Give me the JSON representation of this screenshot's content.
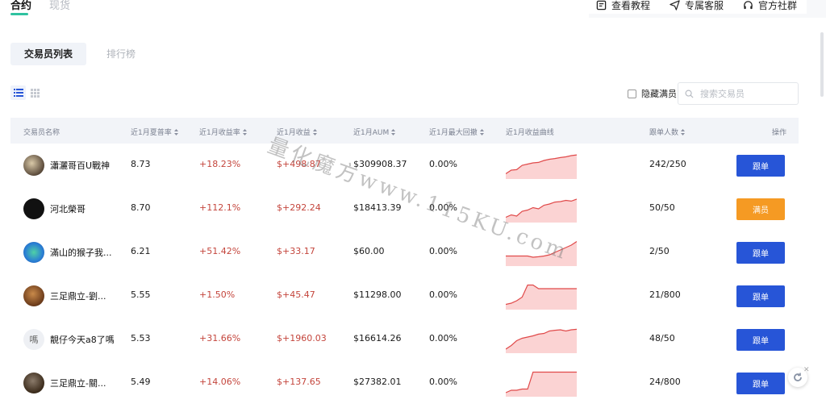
{
  "tabs": [
    {
      "label": "合约",
      "active": true
    },
    {
      "label": "现货",
      "active": false
    }
  ],
  "top_actions": [
    {
      "label": "查看教程",
      "icon": "document-icon"
    },
    {
      "label": "专属客服",
      "icon": "send-icon"
    },
    {
      "label": "官方社群",
      "icon": "headset-icon"
    }
  ],
  "subtabs": [
    {
      "label": "交易员列表",
      "active": true
    },
    {
      "label": "排行榜",
      "active": false
    }
  ],
  "view_toggle": {
    "list_icon": "list-view-icon",
    "grid_icon": "grid-view-icon",
    "active": "list"
  },
  "filters": {
    "hide_full_label": "隐藏满员",
    "hide_full_checked": false
  },
  "search": {
    "placeholder": "搜索交易员",
    "value": ""
  },
  "table": {
    "headers": {
      "name": "交易员名称",
      "sharpe": "近1月夏普率",
      "return_rate": "近1月收益率",
      "profit": "近1月收益",
      "aum": "近1月AUM",
      "max_drawdown": "近1月最大回撤",
      "curve": "近1月收益曲线",
      "followers": "跟单人数",
      "action": "操作"
    },
    "rows": [
      {
        "name": "瀟灑哥百U戰神",
        "sharpe": "8.73",
        "return_rate": "+18.23%",
        "profit": "$+498.87",
        "aum": "$309908.37",
        "drawdown": "0.00%",
        "followers": "242/250",
        "button": "跟单",
        "status": "follow",
        "curve": [
          0.15,
          0.3,
          0.32,
          0.5,
          0.55,
          0.6,
          0.62,
          0.7,
          0.75,
          0.78,
          0.82,
          0.85,
          0.9,
          0.93
        ]
      },
      {
        "name": "河北榮哥",
        "sharpe": "8.70",
        "return_rate": "+112.1%",
        "profit": "$+292.24",
        "aum": "$18413.39",
        "drawdown": "0.00%",
        "followers": "50/50",
        "button": "满员",
        "status": "full",
        "curve": [
          0.15,
          0.25,
          0.2,
          0.4,
          0.45,
          0.55,
          0.5,
          0.65,
          0.7,
          0.78,
          0.8,
          0.85,
          0.82,
          0.9
        ]
      },
      {
        "name": "滿山的猴子我...",
        "sharpe": "6.21",
        "return_rate": "+51.42%",
        "profit": "$+33.17",
        "aum": "$60.00",
        "drawdown": "0.00%",
        "followers": "2/50",
        "button": "跟单",
        "status": "follow",
        "curve": [
          0.35,
          0.35,
          0.35,
          0.35,
          0.35,
          0.3,
          0.32,
          0.35,
          0.4,
          0.5,
          0.6,
          0.7,
          0.8,
          0.95
        ]
      },
      {
        "name": "三足鼎立-劉...",
        "sharpe": "5.55",
        "return_rate": "+1.50%",
        "profit": "$+45.47",
        "aum": "$11298.00",
        "drawdown": "0.00%",
        "followers": "21/800",
        "button": "跟单",
        "status": "follow",
        "curve": [
          0.15,
          0.2,
          0.3,
          0.45,
          0.95,
          0.95,
          0.8,
          0.8,
          0.8,
          0.8,
          0.8,
          0.8,
          0.8,
          0.8
        ]
      },
      {
        "name": "靚仔今天a8了嗎",
        "sharpe": "5.53",
        "return_rate": "+31.66%",
        "profit": "$+1960.03",
        "aum": "$16614.26",
        "drawdown": "0.00%",
        "followers": "48/50",
        "button": "跟单",
        "status": "follow",
        "avatar_text": "嗎",
        "curve": [
          0.1,
          0.25,
          0.45,
          0.55,
          0.6,
          0.65,
          0.72,
          0.75,
          0.85,
          0.88,
          0.9,
          0.85,
          0.9,
          0.92
        ]
      },
      {
        "name": "三足鼎立-關...",
        "sharpe": "5.49",
        "return_rate": "+14.06%",
        "profit": "$+137.65",
        "aum": "$27382.01",
        "drawdown": "0.00%",
        "followers": "24/800",
        "button": "跟单",
        "status": "follow",
        "curve": [
          0.1,
          0.2,
          0.2,
          0.25,
          0.25,
          0.95,
          0.95,
          0.95,
          0.95,
          0.95,
          0.95,
          0.95,
          0.95,
          0.95
        ]
      }
    ]
  },
  "watermark": "量化魔方www.115KU.com",
  "colors": {
    "accent_green": "#2fc2a0",
    "follow_blue": "#2755d7",
    "full_orange": "#f59a23",
    "profit_red": "#c4453c",
    "curve_fill": "#fbd3d3",
    "curve_line": "#e04a4a"
  }
}
